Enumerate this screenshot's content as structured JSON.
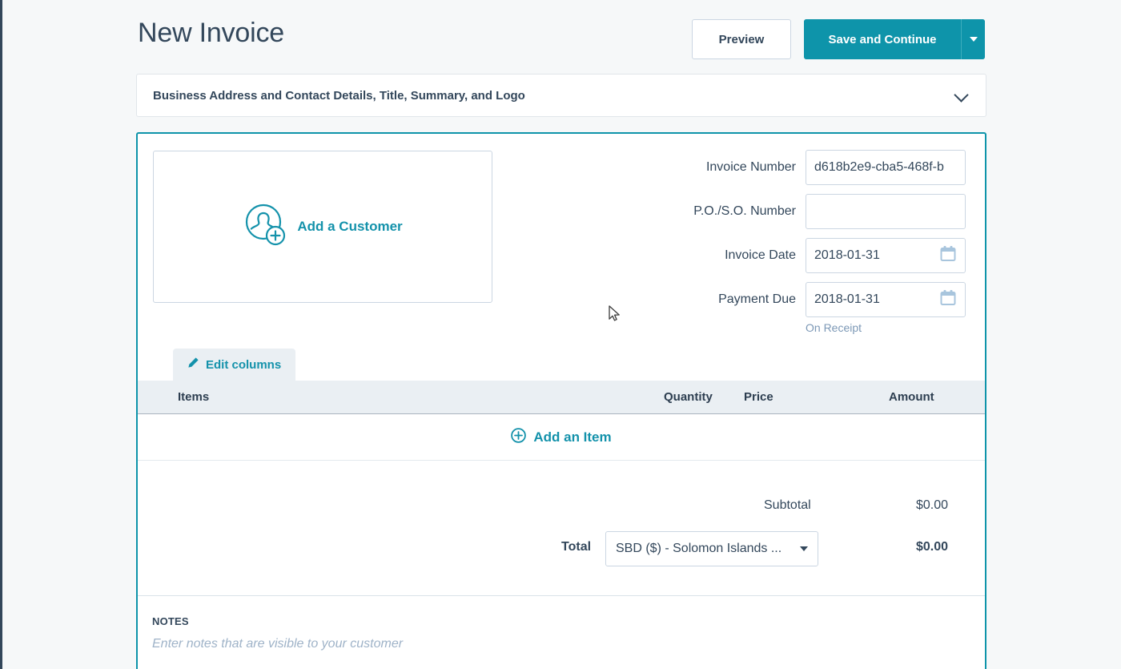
{
  "page": {
    "title": "New Invoice"
  },
  "header": {
    "preview_label": "Preview",
    "save_label": "Save and Continue",
    "save_dropdown_icon": "caret-down-icon"
  },
  "business_section": {
    "label": "Business Address and Contact Details, Title, Summary, and Logo",
    "toggle_icon": "chevron-down-icon"
  },
  "customer": {
    "add_label": "Add a Customer",
    "icon": "add-customer-icon"
  },
  "invoice_fields": [
    {
      "label": "Invoice Number",
      "value": "d618b2e9-cba5-468f-b",
      "placeholder": "",
      "has_calendar": false
    },
    {
      "label": "P.O./S.O. Number",
      "value": "",
      "placeholder": "",
      "has_calendar": false
    },
    {
      "label": "Invoice Date",
      "value": "2018-01-31",
      "placeholder": "",
      "has_calendar": true
    },
    {
      "label": "Payment Due",
      "value": "2018-01-31",
      "placeholder": "",
      "has_calendar": true
    }
  ],
  "payment_due_hint": "On Receipt",
  "edit_columns": {
    "label": "Edit columns",
    "icon": "pencil-icon"
  },
  "items_table": {
    "columns": [
      "Items",
      "Quantity",
      "Price",
      "Amount"
    ],
    "rows": [],
    "add_item_label": "Add an Item",
    "add_item_icon": "plus-circle-icon"
  },
  "totals": {
    "subtotal_label": "Subtotal",
    "subtotal_value": "$0.00",
    "total_label": "Total",
    "total_value": "$0.00",
    "currency_selected": "SBD ($) - Solomon Islands ...",
    "currency_caret_icon": "caret-down-icon"
  },
  "notes": {
    "heading": "NOTES",
    "placeholder": "Enter notes that are visible to your customer"
  },
  "colors": {
    "accent_teal": "#0e94aa",
    "link_teal": "#1492ab",
    "text_navy": "#33475b",
    "page_background": "#f6f8f9",
    "table_header_background": "#eaeff3",
    "border_gray": "#cbd6e2"
  }
}
